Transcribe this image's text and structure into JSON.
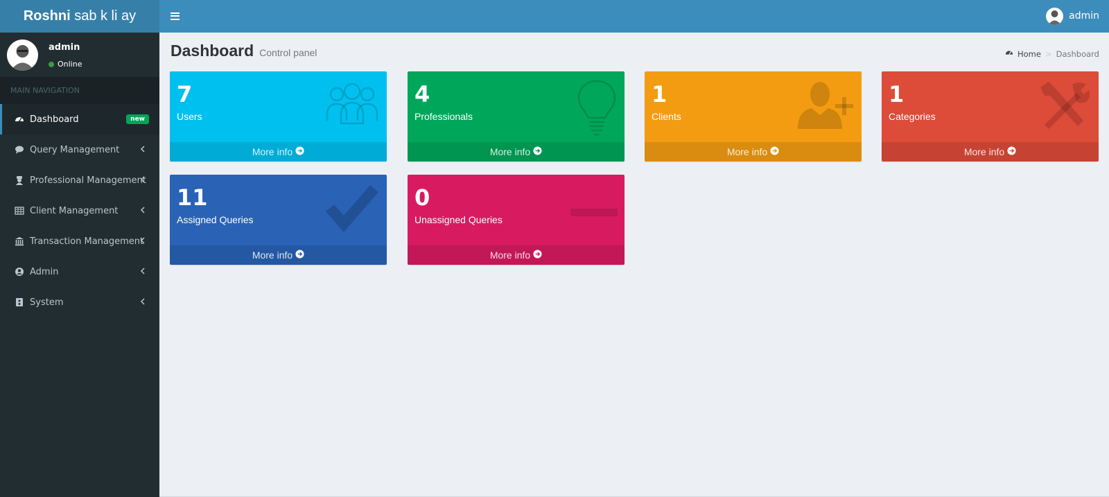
{
  "brand": {
    "bold": "Roshni",
    "rest": " sab k li ay"
  },
  "header": {
    "user_name": "admin"
  },
  "sidebar": {
    "user_name": "admin",
    "status": "Online",
    "nav_header": "MAIN NAVIGATION",
    "items": [
      {
        "label": "Dashboard",
        "icon": "dashboard-icon",
        "badge": "new",
        "active": true
      },
      {
        "label": "Query Management",
        "icon": "comment-icon"
      },
      {
        "label": "Professional Management",
        "icon": "user-secret-icon"
      },
      {
        "label": "Client Management",
        "icon": "table-icon"
      },
      {
        "label": "Transaction Management",
        "icon": "bank-icon"
      },
      {
        "label": "Admin",
        "icon": "user-circle-icon"
      },
      {
        "label": "System",
        "icon": "server-icon"
      }
    ]
  },
  "content": {
    "title": "Dashboard",
    "subtitle": "Control panel",
    "breadcrumb": {
      "home": "Home",
      "current": "Dashboard"
    }
  },
  "boxes": [
    {
      "count": "7",
      "label": "Users",
      "footer": "More info",
      "icon": "users-icon",
      "color": "#00c0ef"
    },
    {
      "count": "4",
      "label": "Professionals",
      "footer": "More info",
      "icon": "lightbulb-icon",
      "color": "#00a65a"
    },
    {
      "count": "1",
      "label": "Clients",
      "footer": "More info",
      "icon": "user-plus-icon",
      "color": "#f39c12"
    },
    {
      "count": "1",
      "label": "Categories",
      "footer": "More info",
      "icon": "wrench-hammer-icon",
      "color": "#dd4b39"
    },
    {
      "count": "11",
      "label": "Assigned Queries",
      "footer": "More info",
      "icon": "check-icon",
      "color": "#0073b7"
    },
    {
      "count": "0",
      "label": "Unassigned Queries",
      "footer": "More info",
      "icon": "minus-icon",
      "color": "#d81b60"
    }
  ],
  "colors": {
    "header": "#3c8dbc",
    "logo": "#367fa9",
    "sidebar": "#222d32",
    "content_bg": "#ecf0f5"
  }
}
